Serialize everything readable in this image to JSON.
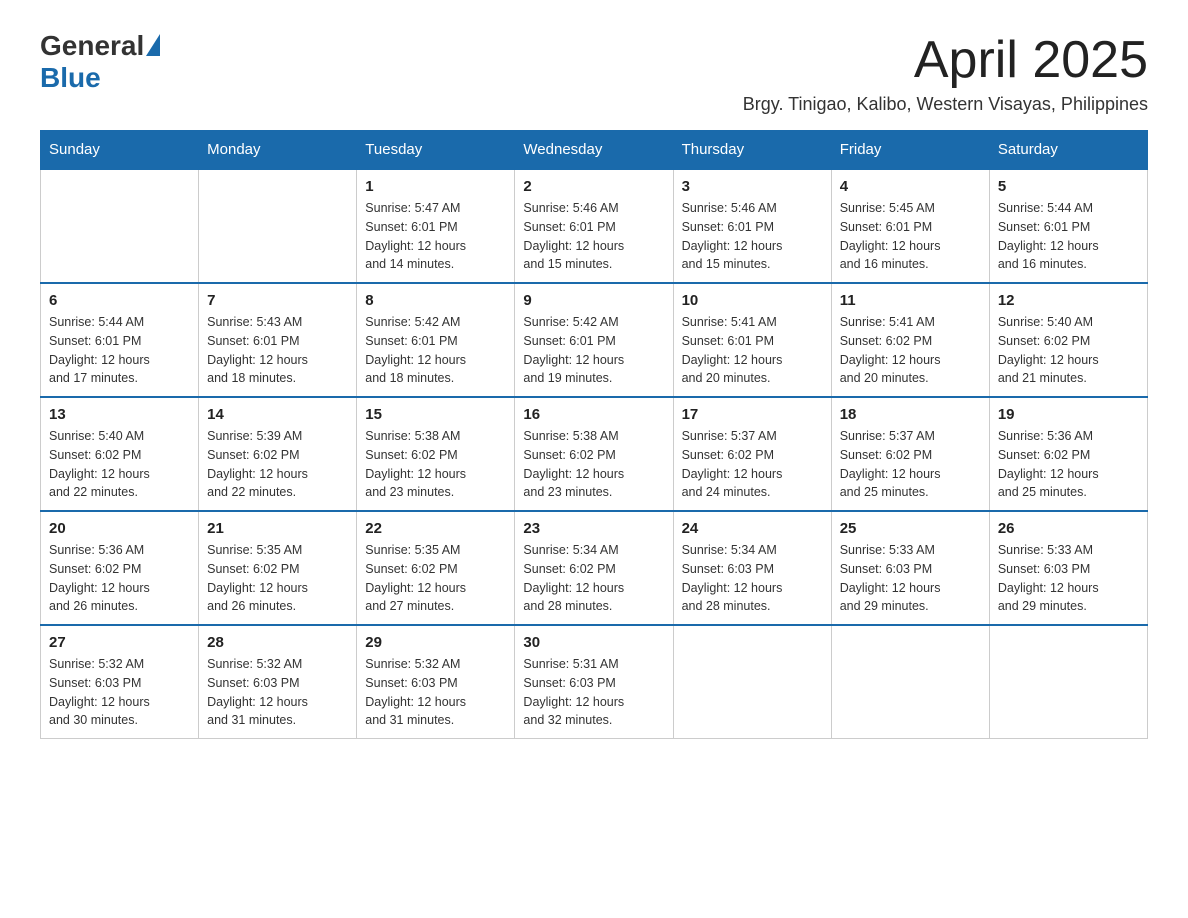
{
  "logo": {
    "general": "General",
    "blue": "Blue"
  },
  "title": "April 2025",
  "subtitle": "Brgy. Tinigao, Kalibo, Western Visayas, Philippines",
  "days_of_week": [
    "Sunday",
    "Monday",
    "Tuesday",
    "Wednesday",
    "Thursday",
    "Friday",
    "Saturday"
  ],
  "weeks": [
    [
      {
        "day": "",
        "info": ""
      },
      {
        "day": "",
        "info": ""
      },
      {
        "day": "1",
        "info": "Sunrise: 5:47 AM\nSunset: 6:01 PM\nDaylight: 12 hours\nand 14 minutes."
      },
      {
        "day": "2",
        "info": "Sunrise: 5:46 AM\nSunset: 6:01 PM\nDaylight: 12 hours\nand 15 minutes."
      },
      {
        "day": "3",
        "info": "Sunrise: 5:46 AM\nSunset: 6:01 PM\nDaylight: 12 hours\nand 15 minutes."
      },
      {
        "day": "4",
        "info": "Sunrise: 5:45 AM\nSunset: 6:01 PM\nDaylight: 12 hours\nand 16 minutes."
      },
      {
        "day": "5",
        "info": "Sunrise: 5:44 AM\nSunset: 6:01 PM\nDaylight: 12 hours\nand 16 minutes."
      }
    ],
    [
      {
        "day": "6",
        "info": "Sunrise: 5:44 AM\nSunset: 6:01 PM\nDaylight: 12 hours\nand 17 minutes."
      },
      {
        "day": "7",
        "info": "Sunrise: 5:43 AM\nSunset: 6:01 PM\nDaylight: 12 hours\nand 18 minutes."
      },
      {
        "day": "8",
        "info": "Sunrise: 5:42 AM\nSunset: 6:01 PM\nDaylight: 12 hours\nand 18 minutes."
      },
      {
        "day": "9",
        "info": "Sunrise: 5:42 AM\nSunset: 6:01 PM\nDaylight: 12 hours\nand 19 minutes."
      },
      {
        "day": "10",
        "info": "Sunrise: 5:41 AM\nSunset: 6:01 PM\nDaylight: 12 hours\nand 20 minutes."
      },
      {
        "day": "11",
        "info": "Sunrise: 5:41 AM\nSunset: 6:02 PM\nDaylight: 12 hours\nand 20 minutes."
      },
      {
        "day": "12",
        "info": "Sunrise: 5:40 AM\nSunset: 6:02 PM\nDaylight: 12 hours\nand 21 minutes."
      }
    ],
    [
      {
        "day": "13",
        "info": "Sunrise: 5:40 AM\nSunset: 6:02 PM\nDaylight: 12 hours\nand 22 minutes."
      },
      {
        "day": "14",
        "info": "Sunrise: 5:39 AM\nSunset: 6:02 PM\nDaylight: 12 hours\nand 22 minutes."
      },
      {
        "day": "15",
        "info": "Sunrise: 5:38 AM\nSunset: 6:02 PM\nDaylight: 12 hours\nand 23 minutes."
      },
      {
        "day": "16",
        "info": "Sunrise: 5:38 AM\nSunset: 6:02 PM\nDaylight: 12 hours\nand 23 minutes."
      },
      {
        "day": "17",
        "info": "Sunrise: 5:37 AM\nSunset: 6:02 PM\nDaylight: 12 hours\nand 24 minutes."
      },
      {
        "day": "18",
        "info": "Sunrise: 5:37 AM\nSunset: 6:02 PM\nDaylight: 12 hours\nand 25 minutes."
      },
      {
        "day": "19",
        "info": "Sunrise: 5:36 AM\nSunset: 6:02 PM\nDaylight: 12 hours\nand 25 minutes."
      }
    ],
    [
      {
        "day": "20",
        "info": "Sunrise: 5:36 AM\nSunset: 6:02 PM\nDaylight: 12 hours\nand 26 minutes."
      },
      {
        "day": "21",
        "info": "Sunrise: 5:35 AM\nSunset: 6:02 PM\nDaylight: 12 hours\nand 26 minutes."
      },
      {
        "day": "22",
        "info": "Sunrise: 5:35 AM\nSunset: 6:02 PM\nDaylight: 12 hours\nand 27 minutes."
      },
      {
        "day": "23",
        "info": "Sunrise: 5:34 AM\nSunset: 6:02 PM\nDaylight: 12 hours\nand 28 minutes."
      },
      {
        "day": "24",
        "info": "Sunrise: 5:34 AM\nSunset: 6:03 PM\nDaylight: 12 hours\nand 28 minutes."
      },
      {
        "day": "25",
        "info": "Sunrise: 5:33 AM\nSunset: 6:03 PM\nDaylight: 12 hours\nand 29 minutes."
      },
      {
        "day": "26",
        "info": "Sunrise: 5:33 AM\nSunset: 6:03 PM\nDaylight: 12 hours\nand 29 minutes."
      }
    ],
    [
      {
        "day": "27",
        "info": "Sunrise: 5:32 AM\nSunset: 6:03 PM\nDaylight: 12 hours\nand 30 minutes."
      },
      {
        "day": "28",
        "info": "Sunrise: 5:32 AM\nSunset: 6:03 PM\nDaylight: 12 hours\nand 31 minutes."
      },
      {
        "day": "29",
        "info": "Sunrise: 5:32 AM\nSunset: 6:03 PM\nDaylight: 12 hours\nand 31 minutes."
      },
      {
        "day": "30",
        "info": "Sunrise: 5:31 AM\nSunset: 6:03 PM\nDaylight: 12 hours\nand 32 minutes."
      },
      {
        "day": "",
        "info": ""
      },
      {
        "day": "",
        "info": ""
      },
      {
        "day": "",
        "info": ""
      }
    ]
  ]
}
